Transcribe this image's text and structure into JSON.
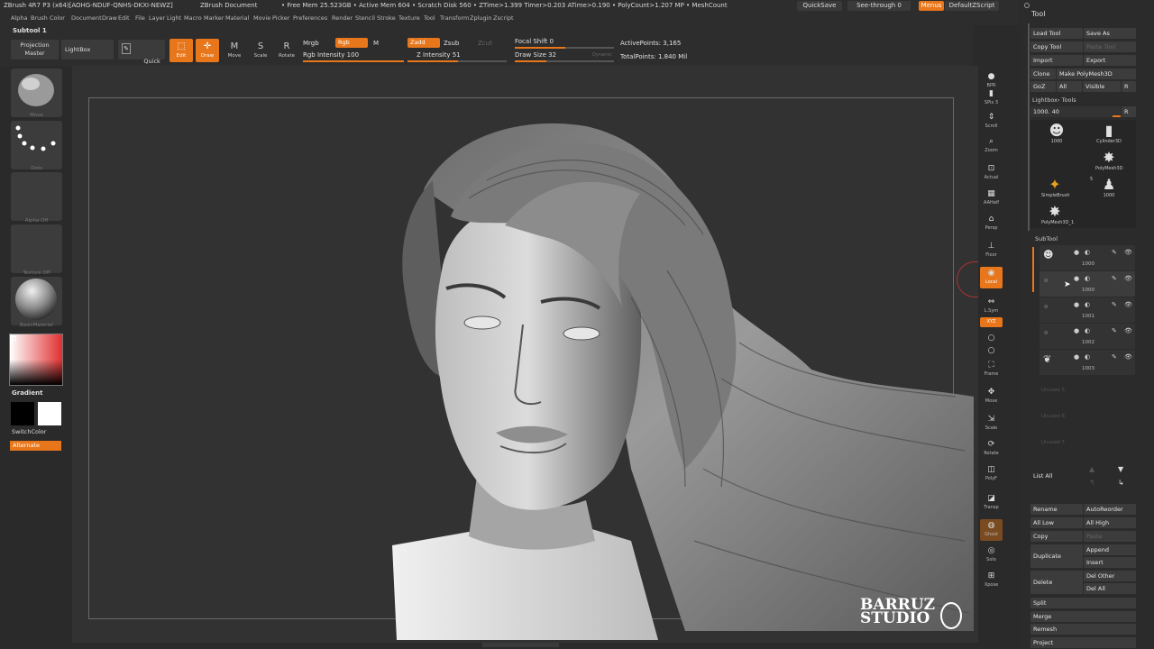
{
  "titlebar": {
    "app": "ZBrush 4R7 P3 (x64)[AOHG-NDUF-QNHS-DKXI-NEWZ]",
    "doc": "ZBrush Document",
    "stats": "• Free Mem 25.523GB • Active Mem 604 • Scratch Disk 560 • ZTime>1.399 Timer>0.203 ATime>0.190 • PolyCount>1.207 MP • MeshCount",
    "quicksave": "QuickSave",
    "seethrough": "See-through   0",
    "menus": "Menus",
    "script": "DefaultZScript"
  },
  "menubar": [
    "Alpha",
    "Brush",
    "Color",
    "Document",
    "Draw",
    "Edit",
    "File",
    "Layer",
    "Light",
    "Macro",
    "Marker",
    "Material",
    "Movie",
    "Picker",
    "Preferences",
    "Render",
    "Stencil",
    "Stroke",
    "Texture",
    "Tool",
    "Transform",
    "Zplugin",
    "Zscript"
  ],
  "shelf": {
    "subtool": "Subtool 1",
    "projection": "Projection\nMaster",
    "lightbox": "LightBox",
    "quicksketch": "Quick\nSketch",
    "edit": "Edit",
    "draw": "Draw",
    "move": "Move",
    "scale": "Scale",
    "rotate": "Rotate",
    "mrgb": "Mrgb",
    "rgb": "Rgb",
    "m": "M",
    "rgb_intensity": "Rgb Intensity 100",
    "zadd": "Zadd",
    "zsub": "Zsub",
    "zcut": "Zcut",
    "z_intensity": "Z Intensity 51",
    "focal_shift": "Focal Shift 0",
    "draw_size": "Draw Size 32",
    "dynamic": "Dynamic",
    "active_points": "ActivePoints: 3,165",
    "total_points": "TotalPoints: 1.840 Mil",
    "rgb_intensity_value": 100,
    "z_intensity_value": 51,
    "draw_size_value": 32
  },
  "lefttray": {
    "brush_label": "Move",
    "stroke_label": "Dots",
    "alpha_label": "Alpha Off",
    "texture_label": "Texture Off",
    "material_label": "BasicMaterial",
    "gradient": "Gradient",
    "switchcolor": "SwitchColor",
    "alternate": "Alternate"
  },
  "righttray": [
    "BPR",
    "SPix 3",
    "Scroll",
    "Zoom",
    "Actual",
    "AAHalf",
    "Persp",
    "Floor",
    "Local",
    "L.Sym",
    "XYZ",
    "",
    "",
    "Frame",
    "Move",
    "Scale",
    "Rotate",
    "PolyF",
    "Transp",
    "Ghost",
    "Solo",
    "Xpose"
  ],
  "watermark": "BARRUZ\nSTUDIO",
  "toolpanel": {
    "title": "Tool",
    "load_tool": "Load Tool",
    "save_as": "Save As",
    "copy_tool": "Copy Tool",
    "paste_tool": "Paste Tool",
    "import": "Import",
    "export": "Export",
    "clone": "Clone",
    "make_polymesh": "Make PolyMesh3D",
    "goz": "GoZ",
    "all": "All",
    "visible": "Visible",
    "r": "R",
    "lightbox_tools": "Lightbox› Tools",
    "tool_value": "1000. 40",
    "tools": [
      {
        "name": "1000",
        "count": "",
        "icon": "head"
      },
      {
        "name": "Cylinder3D",
        "count": "",
        "icon": "cylinder"
      },
      {
        "name": "",
        "count": "",
        "icon": "blank"
      },
      {
        "name": "PolyMesh3D",
        "count": "",
        "icon": "star"
      },
      {
        "name": "SimpleBrush",
        "count": "",
        "icon": "brush"
      },
      {
        "name": "1000",
        "count": "5",
        "icon": "head-small"
      },
      {
        "name": "PolyMesh3D_1",
        "count": "",
        "icon": "star"
      }
    ],
    "subtool_header": "SubTool",
    "subtools": [
      {
        "name": "1000",
        "selected": false
      },
      {
        "name": "1000",
        "selected": true
      },
      {
        "name": "1001",
        "selected": false
      },
      {
        "name": "1002",
        "selected": false
      },
      {
        "name": "1003",
        "selected": false
      }
    ],
    "empty_slots": [
      "Unused 5",
      "Unused 6",
      "Unused 7"
    ],
    "list_all": "List All",
    "rename": "Rename",
    "autoreorder": "AutoReorder",
    "all_low": "All Low",
    "all_high": "All High",
    "copy": "Copy",
    "paste": "Paste",
    "duplicate": "Duplicate",
    "append": "Append",
    "insert": "Insert",
    "delete": "Delete",
    "del_other": "Del Other",
    "del_all": "Del All",
    "split": "Split",
    "merge": "Merge",
    "remesh": "Remesh",
    "project": "Project"
  },
  "colors": {
    "accent": "#e8761a",
    "bg": "#2a2a2a",
    "canvas": "#323232",
    "panel": "#2b2b2b"
  }
}
